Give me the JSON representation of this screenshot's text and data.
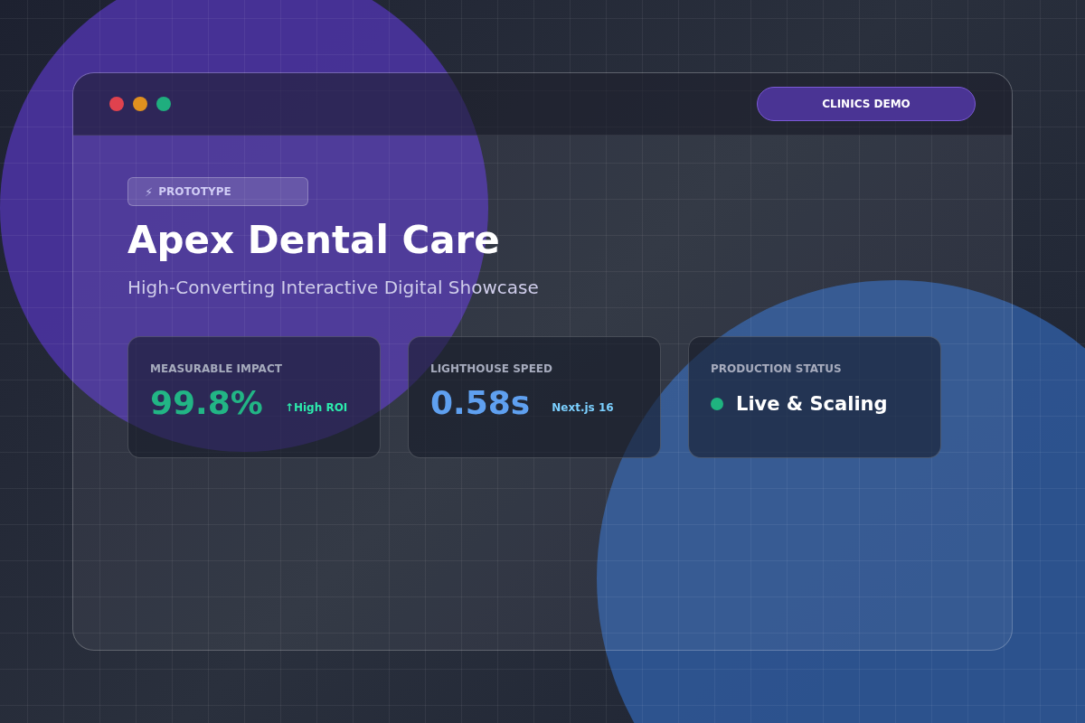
{
  "window": {
    "dots": [
      {
        "color": "#e0424e"
      },
      {
        "color": "#e0901f"
      },
      {
        "color": "#1fae7e"
      }
    ],
    "demo_button": "CLINICS DEMO"
  },
  "badge": {
    "icon": "⚡",
    "label": "PROTOTYPE"
  },
  "title": "Apex Dental Care",
  "subtitle": "High-Converting Interactive Digital Showcase",
  "cards": [
    {
      "kind": "metric",
      "label": "MEASURABLE IMPACT",
      "value": "99.8%",
      "color": "#22b585",
      "note": "↑High ROI"
    },
    {
      "kind": "metric",
      "label": "LIGHTHOUSE SPEED",
      "value": "0.58s",
      "color": "#5fa0f0",
      "note": "Next.js 16"
    },
    {
      "kind": "status",
      "label": "PRODUCTION STATUS",
      "status": "Live & Scaling",
      "color": "#1fb37f"
    }
  ]
}
